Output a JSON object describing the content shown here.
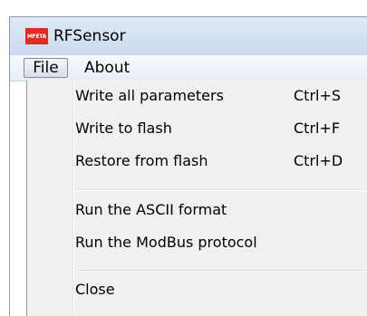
{
  "window": {
    "title": "RFSensor",
    "logo_text": "MFETA",
    "colors": {
      "logo": "#e02b21",
      "titlebar": "#c9daee",
      "menu": "#f0f0f0"
    }
  },
  "menubar": {
    "items": [
      {
        "label": "File",
        "state": "open"
      },
      {
        "label": "About"
      }
    ]
  },
  "file_menu": {
    "items": [
      {
        "label": "Write all parameters",
        "shortcut": "Ctrl+S"
      },
      {
        "label": "Write to flash",
        "shortcut": "Ctrl+F"
      },
      {
        "label": "Restore from flash",
        "shortcut": "Ctrl+D"
      },
      {
        "label": "Run the ASCII format",
        "shortcut": ""
      },
      {
        "label": "Run the ModBus protocol",
        "shortcut": ""
      },
      {
        "label": "Close",
        "shortcut": ""
      }
    ]
  }
}
